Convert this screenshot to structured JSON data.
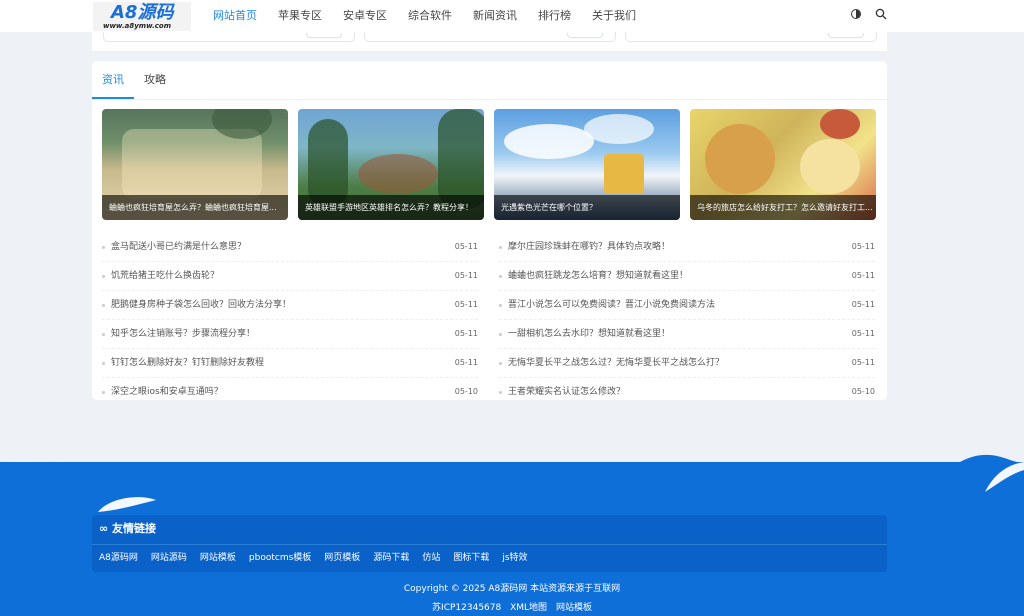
{
  "header": {
    "logo_text": "A8源码",
    "logo_url": "www.a8ymw.com",
    "nav": [
      {
        "label": "网站首页",
        "active": true
      },
      {
        "label": "苹果专区",
        "active": false
      },
      {
        "label": "安卓专区",
        "active": false
      },
      {
        "label": "综合软件",
        "active": false
      },
      {
        "label": "新闻资讯",
        "active": false
      },
      {
        "label": "排行榜",
        "active": false
      },
      {
        "label": "关于我们",
        "active": false
      }
    ],
    "icons": {
      "theme": "contrast-icon",
      "search": "search-icon"
    }
  },
  "tabs": [
    {
      "label": "资讯",
      "active": true
    },
    {
      "label": "攻略",
      "active": false
    }
  ],
  "featured": [
    {
      "caption": "蛐蛐也疯狂培育屋怎么弄？蛐蛐也疯狂培育屋..."
    },
    {
      "caption": "英雄联盟手游地区英雄排名怎么弄？教程分享！"
    },
    {
      "caption": "光遇紫色光芒在哪个位置？"
    },
    {
      "caption": "乌冬的旅店怎么给好友打工？怎么邀请好友打工..."
    }
  ],
  "news_left": [
    {
      "title": "盒马配送小哥已约满是什么意思？",
      "date": "05-11"
    },
    {
      "title": "饥荒给猪王吃什么换齿轮？",
      "date": "05-11"
    },
    {
      "title": "肥鹅健身房种子袋怎么回收？回收方法分享！",
      "date": "05-11"
    },
    {
      "title": "知乎怎么注销账号？步骤流程分享！",
      "date": "05-11"
    },
    {
      "title": "钉钉怎么删除好友？钉钉删除好友教程",
      "date": "05-11"
    },
    {
      "title": "深空之眼ios和安卓互通吗？",
      "date": "05-10"
    }
  ],
  "news_right": [
    {
      "title": "摩尔庄园珍珠蚌在哪钓？具体钓点攻略！",
      "date": "05-11"
    },
    {
      "title": "蛐蛐也疯狂跳龙怎么培育？想知道就看这里！",
      "date": "05-11"
    },
    {
      "title": "晋江小说怎么可以免费阅读？晋江小说免费阅读方法",
      "date": "05-11"
    },
    {
      "title": "一甜相机怎么去水印？想知道就看这里！",
      "date": "05-11"
    },
    {
      "title": "无悔华夏长平之战怎么过？无悔华夏长平之战怎么打？",
      "date": "05-11"
    },
    {
      "title": "王者荣耀实名认证怎么修改？",
      "date": "05-10"
    }
  ],
  "footer": {
    "friends_title": "∞ 友情链接",
    "friends_links": [
      "A8源码网",
      "网站源码",
      "网站模板",
      "pbootcms模板",
      "网页模板",
      "源码下载",
      "仿站",
      "图标下载",
      "js特效"
    ],
    "copyright": "Copyright © 2025 A8源码网 本站资源来源于互联网",
    "links": [
      "苏ICP12345678",
      "XML地图",
      "网站模板"
    ]
  },
  "colors": {
    "accent": "#1e8ae6",
    "footer": "#0f6fd9",
    "footer_dark": "#0a62c9"
  }
}
